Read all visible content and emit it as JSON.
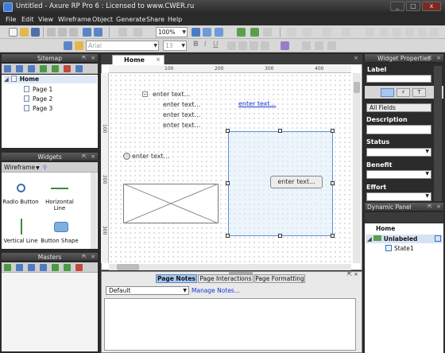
{
  "window": {
    "title": "Untitled - Axure RP Pro 6 : Licensed to www.CWER.ru"
  },
  "menu": [
    "File",
    "Edit",
    "View",
    "Wireframe",
    "Object",
    "Generate",
    "Share",
    "Help"
  ],
  "toolbar": {
    "zoom": "100%",
    "font": "Arial",
    "font_size": "13"
  },
  "sitemap": {
    "title": "Sitemap",
    "root": "Home",
    "pages": [
      "Page 1",
      "Page 2",
      "Page 3"
    ]
  },
  "widgets": {
    "title": "Widgets",
    "library": "Wireframe",
    "items": [
      "Radio Button",
      "Horizontal Line",
      "Vertical Line",
      "Button Shape"
    ]
  },
  "masters": {
    "title": "Masters"
  },
  "editor": {
    "tab": "Home",
    "ruler_h": [
      "100",
      "200",
      "300",
      "400"
    ],
    "ruler_v": [
      "100",
      "200",
      "300"
    ],
    "tree_text": "enter text...",
    "bullets": [
      "enter text...",
      "enter text...",
      "enter text..."
    ],
    "link_text": "enter text...",
    "radio_text": "enter text...",
    "button_text": "enter text..."
  },
  "notes": {
    "tabs": [
      "Page Notes",
      "Page Interactions",
      "Page Formatting"
    ],
    "default_select": "Default",
    "manage_link": "Manage Notes..."
  },
  "widget_properties": {
    "title": "Widget Properties",
    "label": "Label",
    "all_fields": "All Fields",
    "fields": [
      "Description",
      "Status",
      "Benefit",
      "Effort"
    ]
  },
  "dynamic_panel": {
    "title": "Dynamic Panel",
    "root": "Home",
    "panel": "Unlabeled",
    "state": "State1"
  }
}
